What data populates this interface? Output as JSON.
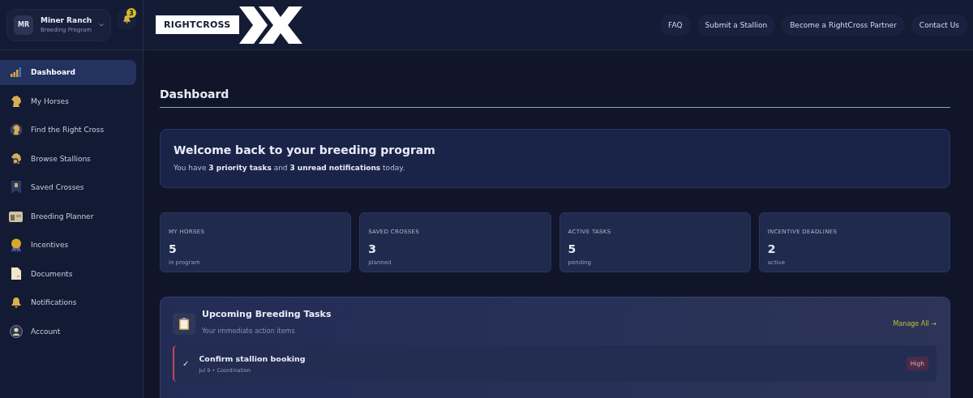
{
  "account": {
    "initials": "MR",
    "name": "Miner Ranch",
    "subtitle": "Breeding Program",
    "notification_count": "3"
  },
  "logo": {
    "text": "RIGHTCROSS"
  },
  "nav_links": [
    "FAQ",
    "Submit a Stallion",
    "Become a RightCross Partner",
    "Contact Us"
  ],
  "sidebar": {
    "items": [
      {
        "label": "Dashboard",
        "selected": true
      },
      {
        "label": "My Horses",
        "selected": false
      },
      {
        "label": "Find the Right Cross",
        "selected": false
      },
      {
        "label": "Browse Stallions",
        "selected": false
      },
      {
        "label": "Saved Crosses",
        "selected": false
      },
      {
        "label": "Breeding Planner",
        "selected": false
      },
      {
        "label": "Incentives",
        "selected": false
      },
      {
        "label": "Documents",
        "selected": false
      },
      {
        "label": "Notifications",
        "selected": false
      },
      {
        "label": "Account",
        "selected": false
      }
    ]
  },
  "page_title": "Dashboard",
  "welcome": {
    "title": "Welcome back to your breeding program",
    "text": "You have **3 priority tasks** and **3 unread notifications** today."
  },
  "stats": [
    {
      "label": "MY HORSES",
      "value": "5",
      "caption": "in program"
    },
    {
      "label": "SAVED CROSSES",
      "value": "3",
      "caption": "planned"
    },
    {
      "label": "ACTIVE TASKS",
      "value": "5",
      "caption": "pending"
    },
    {
      "label": "INCENTIVE DEADLINES",
      "value": "2",
      "caption": "active"
    }
  ],
  "tasks_panel": {
    "title": "Upcoming Breeding Tasks",
    "subtitle": "Your immediate action items",
    "action": "Manage All →",
    "tasks": [
      {
        "check": "✓",
        "title": "Confirm stallion booking",
        "meta": "Jul 9 • Coordination",
        "priority": "High",
        "color": "#c0485a"
      }
    ]
  }
}
